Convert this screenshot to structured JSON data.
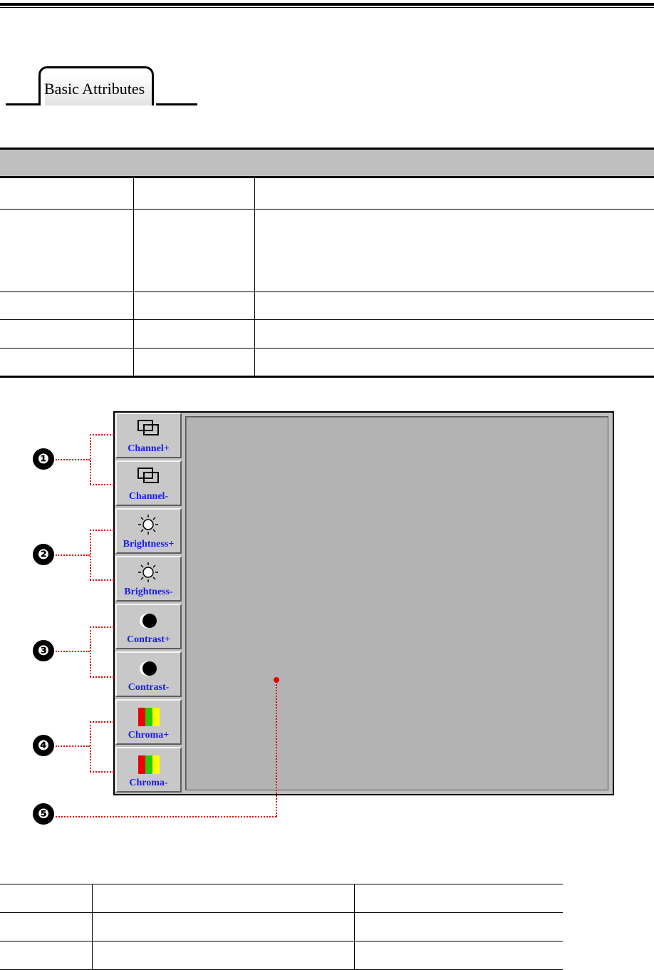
{
  "section_tab": {
    "label": "Basic Attributes"
  },
  "diagram": {
    "buttons": [
      {
        "label": "Channel+",
        "icon": "channel-icon"
      },
      {
        "label": "Channel-",
        "icon": "channel-icon"
      },
      {
        "label": "Brightness+",
        "icon": "brightness-sun-icon"
      },
      {
        "label": "Brightness-",
        "icon": "brightness-sun-icon"
      },
      {
        "label": "Contrast+",
        "icon": "contrast-icon"
      },
      {
        "label": "Contrast-",
        "icon": "contrast-icon"
      },
      {
        "label": "Chroma+",
        "icon": "chroma-bars-icon"
      },
      {
        "label": "Chroma-",
        "icon": "chroma-bars-icon"
      }
    ],
    "callouts": [
      "❶",
      "❷",
      "❸",
      "❹",
      "❺"
    ],
    "colors": {
      "label_blue": "#1a1aee",
      "callout_red": "#e00000",
      "chroma_red": "#ee0000",
      "chroma_green": "#22cc00",
      "chroma_yellow": "#ffff00"
    }
  }
}
